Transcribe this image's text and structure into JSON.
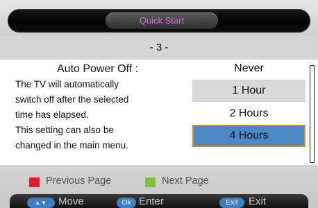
{
  "header": {
    "title": "Quick Start"
  },
  "page": {
    "indicator": "- 3 -"
  },
  "setting": {
    "title": "Auto Power Off :",
    "description_lines": [
      "The TV will automatically",
      "switch off after the selected",
      "time has elapsed.",
      "This setting can also be",
      "changed in the main menu."
    ]
  },
  "options": [
    {
      "label": "Never"
    },
    {
      "label": "1 Hour"
    },
    {
      "label": "2 Hours"
    },
    {
      "label": "4 Hours",
      "selected": true
    }
  ],
  "hints": {
    "previous_page": "Previous Page",
    "next_page": "Next Page",
    "previous_color": "#e31d2d",
    "next_color": "#7fc43a"
  },
  "footer": {
    "move_key": "▲▼",
    "move_label": "Move",
    "ok_key": "Ok",
    "enter_label": "Enter",
    "exit_key": "Exit",
    "exit_label": "Exit"
  },
  "colors": {
    "accent": "#4c87c8",
    "selection_border": "#e38a18",
    "title_text": "#cc66dd"
  }
}
